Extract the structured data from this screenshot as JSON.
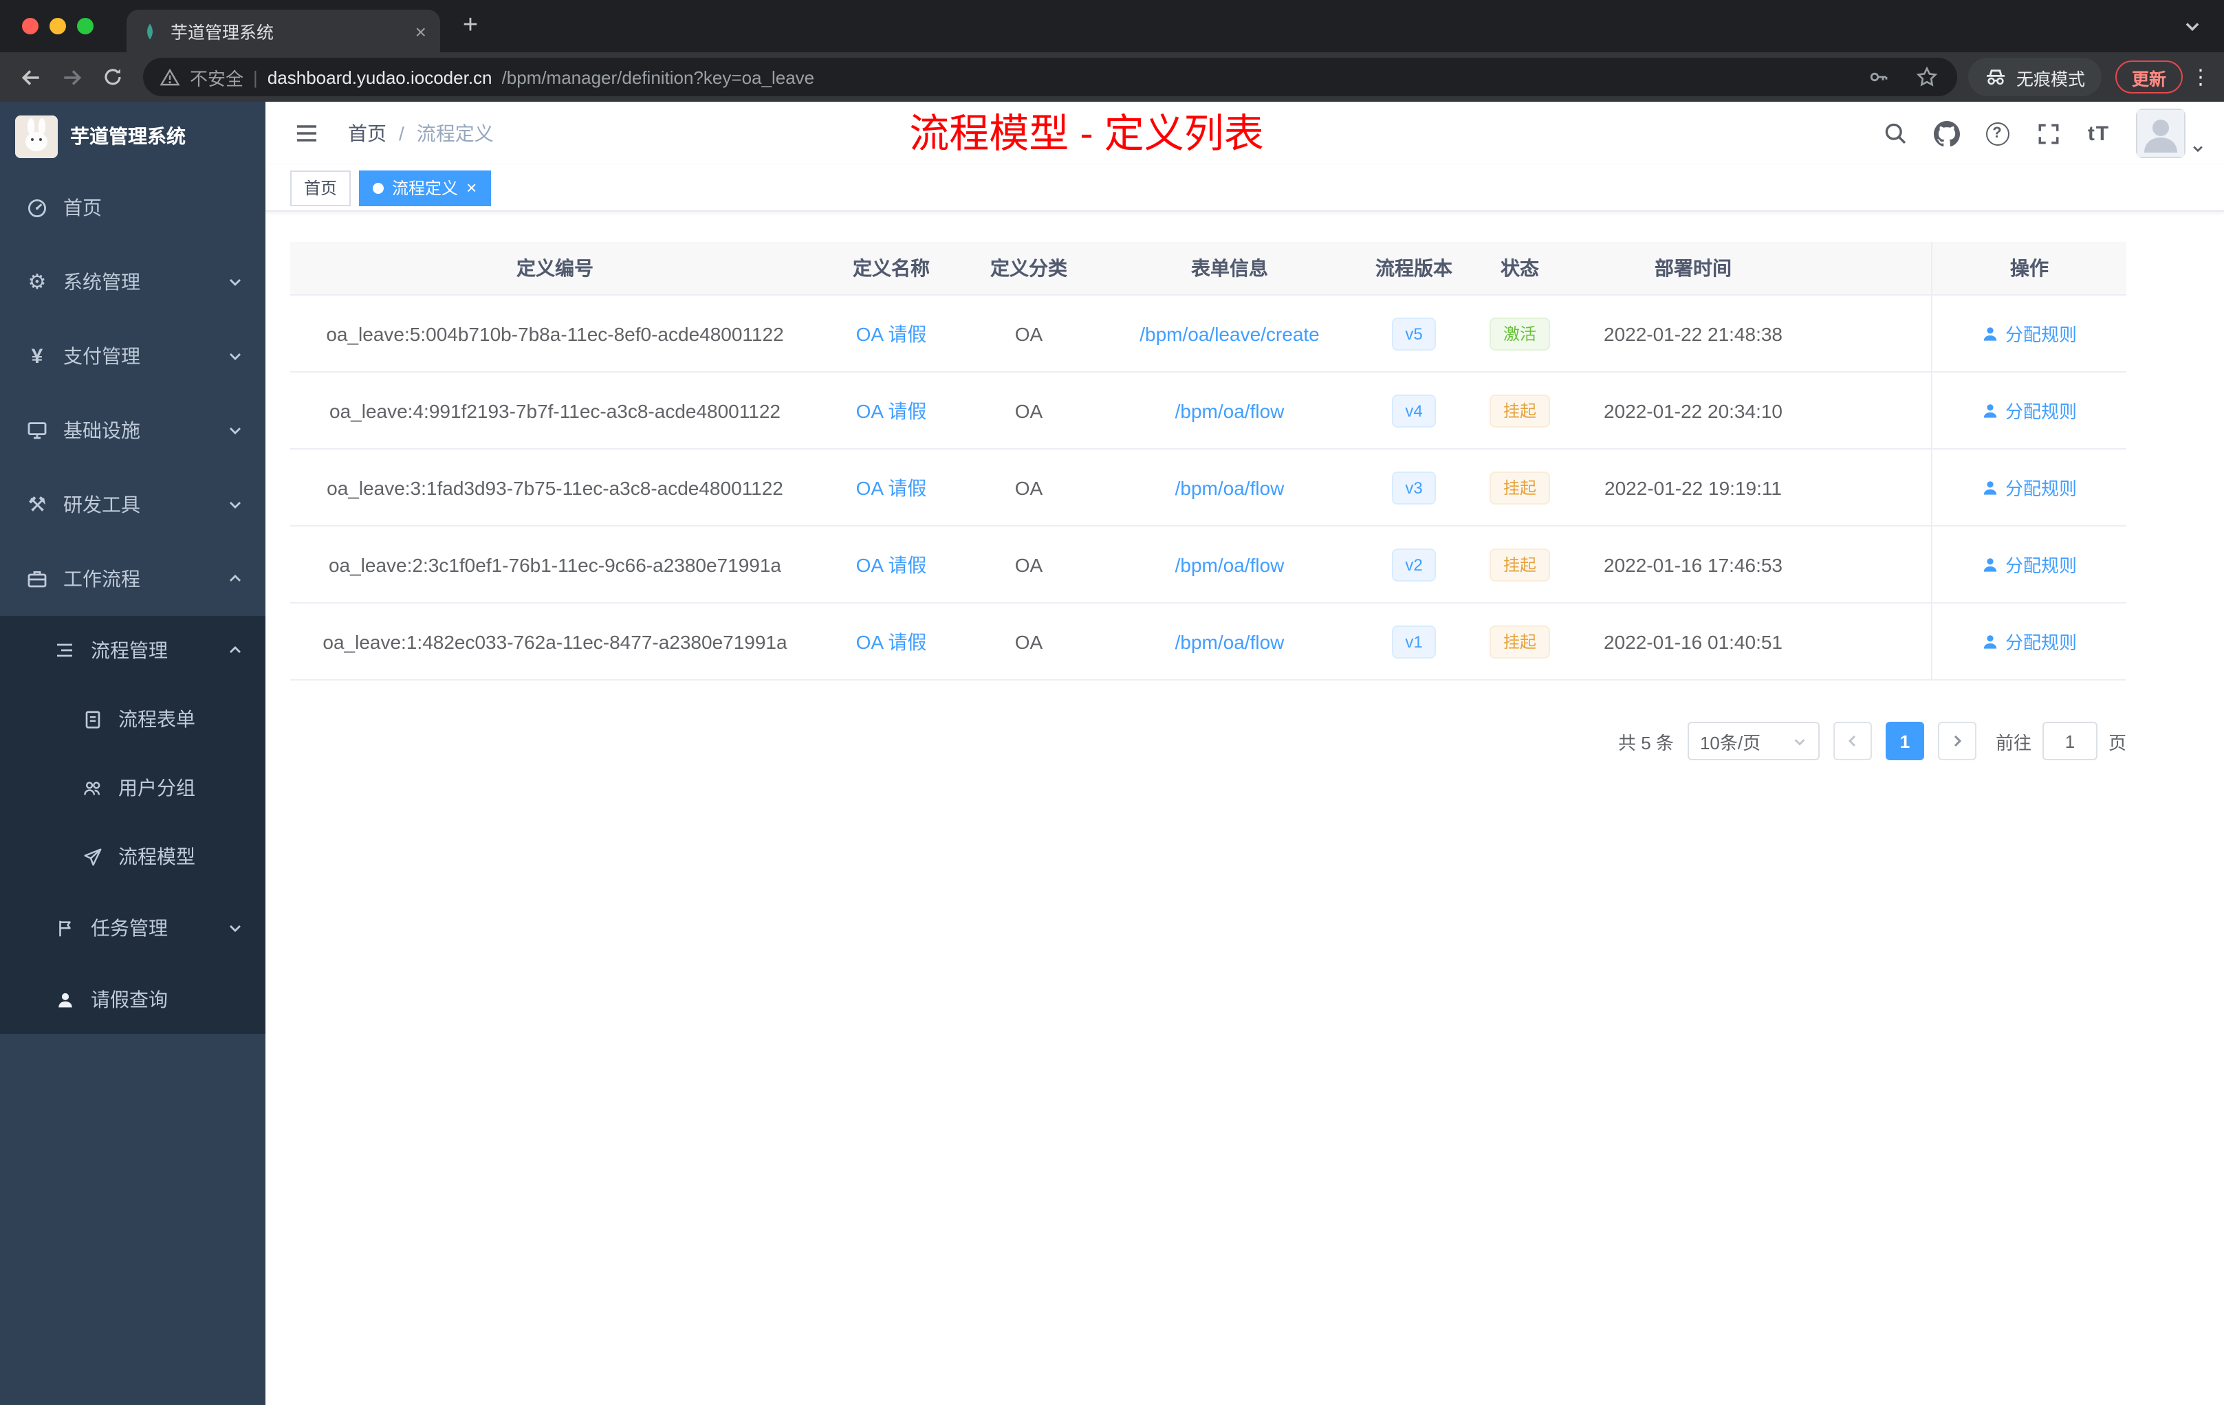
{
  "colors": {
    "accent": "#409eff",
    "success": "#67c23a",
    "warning": "#e6a23c",
    "annotation_red": "#ff0000",
    "sidebar_bg": "#304156",
    "submenu_bg": "#1f2d3d",
    "active_tag_bg": "#409eff"
  },
  "icons": {
    "close": "×",
    "plus": "+",
    "kebab": "⋮",
    "gear": "⚙",
    "yen": "¥",
    "tool": "⚒",
    "question": "?",
    "font_size": "tT"
  },
  "browser": {
    "tab": {
      "title": "芋道管理系统"
    },
    "security_label": "不安全",
    "url_host": "dashboard.yudao.iocoder.cn",
    "url_path": "/bpm/manager/definition?key=oa_leave",
    "incognito_label": "无痕模式",
    "update_label": "更新"
  },
  "sidebar": {
    "title": "芋道管理系统",
    "items": [
      {
        "label": "首页"
      },
      {
        "label": "系统管理"
      },
      {
        "label": "支付管理"
      },
      {
        "label": "基础设施"
      },
      {
        "label": "研发工具"
      },
      {
        "label": "工作流程"
      },
      {
        "label": "流程管理"
      },
      {
        "label": "流程表单"
      },
      {
        "label": "用户分组"
      },
      {
        "label": "流程模型"
      },
      {
        "label": "任务管理"
      },
      {
        "label": "请假查询"
      }
    ]
  },
  "navbar": {
    "breadcrumb_home": "首页",
    "breadcrumb_sep": "/",
    "breadcrumb_current": "流程定义",
    "annotation": "流程模型 - 定义列表"
  },
  "tags": {
    "home": "首页",
    "active": "流程定义"
  },
  "table": {
    "columns": {
      "id": "定义编号",
      "name": "定义名称",
      "category": "定义分类",
      "form": "表单信息",
      "version": "流程版本",
      "status": "状态",
      "deploy_time": "部署时间",
      "action": "操作"
    },
    "rows": [
      {
        "id": "oa_leave:5:004b710b-7b8a-11ec-8ef0-acde48001122",
        "name": "OA 请假",
        "category": "OA",
        "form": "/bpm/oa/leave/create",
        "version": "v5",
        "status": "激活",
        "status_type": "success",
        "deploy_time": "2022-01-22 21:48:38",
        "action": "分配规则"
      },
      {
        "id": "oa_leave:4:991f2193-7b7f-11ec-a3c8-acde48001122",
        "name": "OA 请假",
        "category": "OA",
        "form": "/bpm/oa/flow",
        "version": "v4",
        "status": "挂起",
        "status_type": "warning",
        "deploy_time": "2022-01-22 20:34:10",
        "action": "分配规则"
      },
      {
        "id": "oa_leave:3:1fad3d93-7b75-11ec-a3c8-acde48001122",
        "name": "OA 请假",
        "category": "OA",
        "form": "/bpm/oa/flow",
        "version": "v3",
        "status": "挂起",
        "status_type": "warning",
        "deploy_time": "2022-01-22 19:19:11",
        "action": "分配规则"
      },
      {
        "id": "oa_leave:2:3c1f0ef1-76b1-11ec-9c66-a2380e71991a",
        "name": "OA 请假",
        "category": "OA",
        "form": "/bpm/oa/flow",
        "version": "v2",
        "status": "挂起",
        "status_type": "warning",
        "deploy_time": "2022-01-16 17:46:53",
        "action": "分配规则"
      },
      {
        "id": "oa_leave:1:482ec033-762a-11ec-8477-a2380e71991a",
        "name": "OA 请假",
        "category": "OA",
        "form": "/bpm/oa/flow",
        "version": "v1",
        "status": "挂起",
        "status_type": "warning",
        "deploy_time": "2022-01-16 01:40:51",
        "action": "分配规则"
      }
    ]
  },
  "pagination": {
    "total": "共 5 条",
    "page_size": "10条/页",
    "current_page": "1",
    "goto_label": "前往",
    "goto_value": "1",
    "page_suffix": "页"
  }
}
